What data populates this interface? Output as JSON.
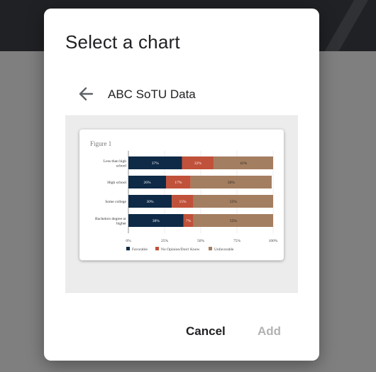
{
  "dialog": {
    "title": "Select a chart",
    "dataset_title": "ABC SoTU Data",
    "cancel_label": "Cancel",
    "add_label": "Add",
    "back_icon": "arrow-left-icon"
  },
  "colors": {
    "favorable": "#0e2a47",
    "no_opinion": "#c0513a",
    "unfavorable": "#a47e60",
    "add_disabled": "#b3b3b3"
  },
  "chart_data": {
    "type": "bar",
    "orientation": "horizontal",
    "stacked": true,
    "title": "Figure 1",
    "categories": [
      "Less than high school",
      "High school",
      "Some college",
      "Bachelors degree or higher"
    ],
    "category_lines": [
      [
        "Less than high",
        "school"
      ],
      [
        "High school"
      ],
      [
        "Some college"
      ],
      [
        "Bachelors degree or",
        "higher"
      ]
    ],
    "series": [
      {
        "name": "Favorable",
        "values": [
          37,
          26,
          30,
          38
        ],
        "labels": [
          "37%",
          "26%",
          "30%",
          "38%"
        ]
      },
      {
        "name": "No Opinion/Don't Know",
        "values": [
          22,
          17,
          15,
          7
        ],
        "labels": [
          "22%",
          "17%",
          "15%",
          "7%"
        ]
      },
      {
        "name": "Unfavorable",
        "values": [
          41,
          56,
          55,
          55
        ],
        "labels": [
          "41%",
          "56%",
          "55%",
          "55%"
        ]
      }
    ],
    "xlim": [
      0,
      100
    ],
    "x_ticks": [
      "0%",
      "25%",
      "50%",
      "75%",
      "100%"
    ],
    "grid": true,
    "legend": "bottom"
  }
}
